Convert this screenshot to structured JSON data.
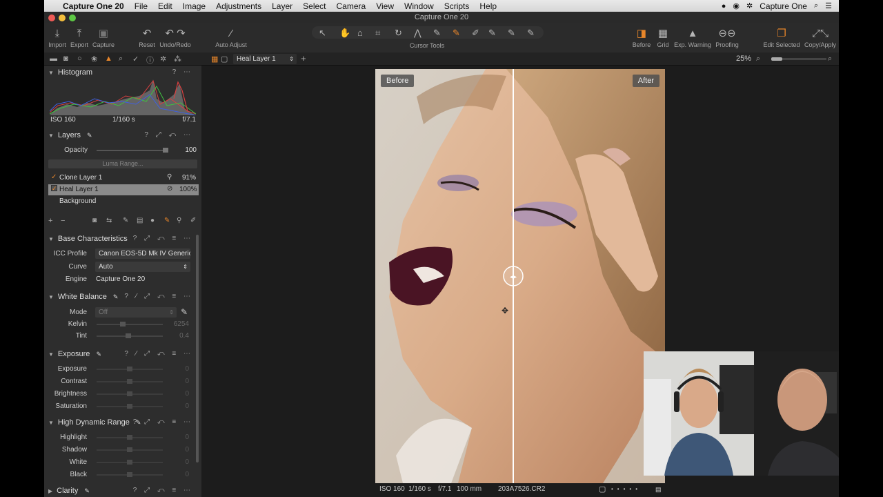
{
  "menubar": {
    "app_name": "Capture One 20",
    "items": [
      "File",
      "Edit",
      "Image",
      "Adjustments",
      "Layer",
      "Select",
      "Camera",
      "View",
      "Window",
      "Scripts",
      "Help"
    ],
    "right_label": "Capture One"
  },
  "window": {
    "title": "Capture One 20"
  },
  "toolbar": {
    "import": "Import",
    "export": "Export",
    "capture": "Capture",
    "reset": "Reset",
    "undo_redo": "Undo/Redo",
    "auto_adjust": "Auto Adjust",
    "cursor_tools": "Cursor Tools",
    "before": "Before",
    "grid": "Grid",
    "exp_warning": "Exp. Warning",
    "proofing": "Proofing",
    "edit_selected": "Edit Selected",
    "copy_apply": "Copy/Apply"
  },
  "tabstrip": {
    "layer_select": "Heal Layer 1",
    "zoom": "25%"
  },
  "histogram": {
    "title": "Histogram",
    "iso": "ISO 160",
    "shutter": "1/160 s",
    "aperture": "f/7.1"
  },
  "layers": {
    "title": "Layers",
    "opacity_label": "Opacity",
    "opacity_value": "100",
    "opacity_level": 1.0,
    "luma_range": "Luma Range...",
    "list": [
      {
        "name": "Clone Layer 1",
        "value": "91%",
        "checked": true
      },
      {
        "name": "Heal Layer 1",
        "value": "100%",
        "checked": true
      },
      {
        "name": "Background",
        "value": "",
        "checked": false
      }
    ]
  },
  "base": {
    "title": "Base Characteristics",
    "icc_label": "ICC Profile",
    "icc_value": "Canon EOS-5D Mk IV Generic",
    "curve_label": "Curve",
    "curve_value": "Auto",
    "engine_label": "Engine",
    "engine_value": "Capture One 20"
  },
  "white_balance": {
    "title": "White Balance",
    "mode_label": "Mode",
    "mode_value": "Off",
    "kelvin_label": "Kelvin",
    "kelvin_value": "6254",
    "tint_label": "Tint",
    "tint_value": "0.4"
  },
  "exposure": {
    "title": "Exposure",
    "rows": [
      {
        "label": "Exposure",
        "value": "0"
      },
      {
        "label": "Contrast",
        "value": "0"
      },
      {
        "label": "Brightness",
        "value": "0"
      },
      {
        "label": "Saturation",
        "value": "0"
      }
    ]
  },
  "hdr": {
    "title": "High Dynamic Range",
    "rows": [
      {
        "label": "Highlight",
        "value": "0"
      },
      {
        "label": "Shadow",
        "value": "0"
      },
      {
        "label": "White",
        "value": "0"
      },
      {
        "label": "Black",
        "value": "0"
      }
    ]
  },
  "clarity": {
    "title": "Clarity"
  },
  "viewer": {
    "before_label": "Before",
    "after_label": "After",
    "info": {
      "iso": "ISO 160",
      "shutter": "1/160 s",
      "aperture": "f/7.1",
      "focal": "100 mm",
      "filename": "203A7526.CR2"
    }
  },
  "colors": {
    "accent": "#e8862a",
    "panel": "#2d2d2d",
    "viewer_bg": "#1c1c1c"
  }
}
